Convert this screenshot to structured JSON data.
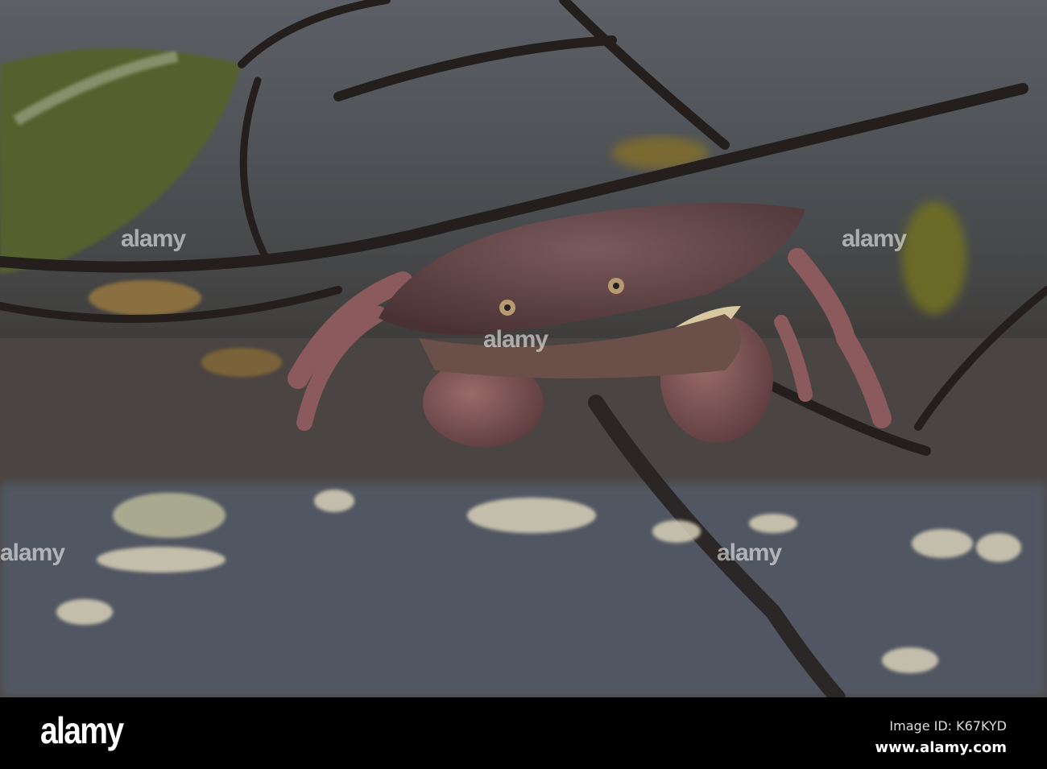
{
  "photo": {
    "subject": "crab",
    "colors": {
      "shell": "#6a4a4c",
      "kelp": "#2a2422",
      "leaf": "#5a6030",
      "rock": "#3e3a38"
    }
  },
  "watermark": {
    "text": "alamy"
  },
  "footer": {
    "logo": "alamy",
    "image_id": "Image ID: K67KYD",
    "site": "www.alamy.com"
  }
}
